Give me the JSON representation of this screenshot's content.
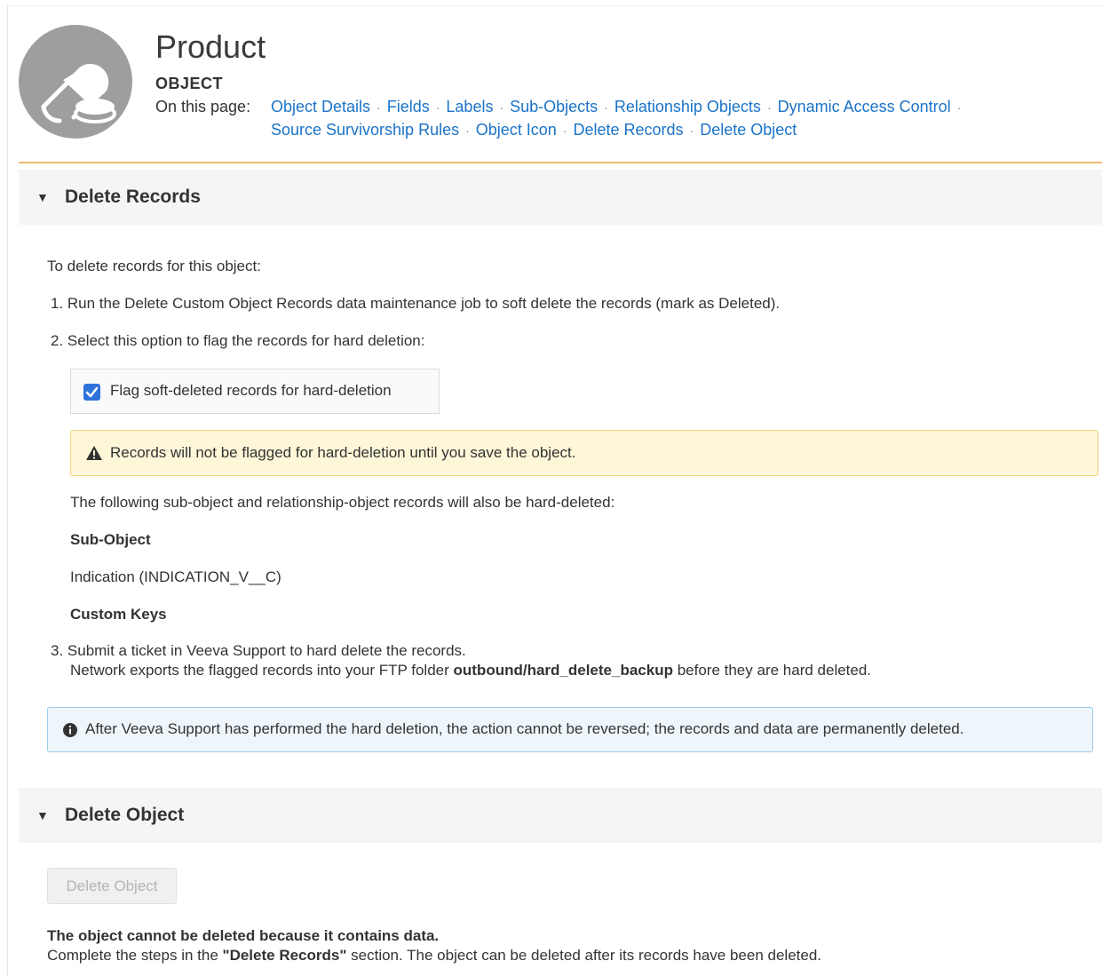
{
  "header": {
    "title": "Product",
    "subtitle": "OBJECT",
    "on_this_page_label": "On this page:",
    "links": [
      "Object Details",
      "Fields",
      "Labels",
      "Sub-Objects",
      "Relationship Objects",
      "Dynamic Access Control",
      "Source Survivorship Rules",
      "Object Icon",
      "Delete Records",
      "Delete Object"
    ]
  },
  "delete_records": {
    "title": "Delete Records",
    "intro": "To delete records for this object:",
    "step1": "1. Run the Delete Custom Object Records data maintenance job to soft delete the records (mark as Deleted).",
    "step2": "2. Select this option to flag the records for hard deletion:",
    "checkbox_label": "Flag soft-deleted records for hard-deletion",
    "checkbox_checked": true,
    "warning": "Records will not be flagged for hard-deletion until you save the object.",
    "following_text": "The following sub-object and relationship-object records will also be hard-deleted:",
    "subobject_heading": "Sub-Object",
    "subobject_value": "Indication (INDICATION_V__C)",
    "custom_keys_heading": "Custom Keys",
    "step3": "3. Submit a ticket in Veeva Support to hard delete the records.",
    "step3_line2_pre": "Network exports the flagged records into your FTP folder ",
    "step3_folder": "outbound/hard_delete_backup",
    "step3_line2_post": " before they are hard deleted.",
    "info": "After Veeva Support has performed the hard deletion, the action cannot be reversed; the records and data are permanently deleted."
  },
  "delete_object": {
    "title": "Delete Object",
    "button_label": "Delete Object",
    "error_title": "The object cannot be deleted because it contains data.",
    "msg_pre": "Complete the steps in the ",
    "msg_bold": "\"Delete Records\"",
    "msg_post": " section. The object can be deleted after its records have been deleted."
  },
  "colors": {
    "link": "#1a73c8",
    "accent_rule": "#f0b86e",
    "warning_bg": "#fdf6d8",
    "info_bg": "#eef6fb",
    "checkbox": "#2f73d9"
  },
  "icons": {
    "avatar": "pill-icon",
    "collapse": "triangle-down-icon",
    "warning": "warning-icon",
    "info": "info-icon"
  }
}
